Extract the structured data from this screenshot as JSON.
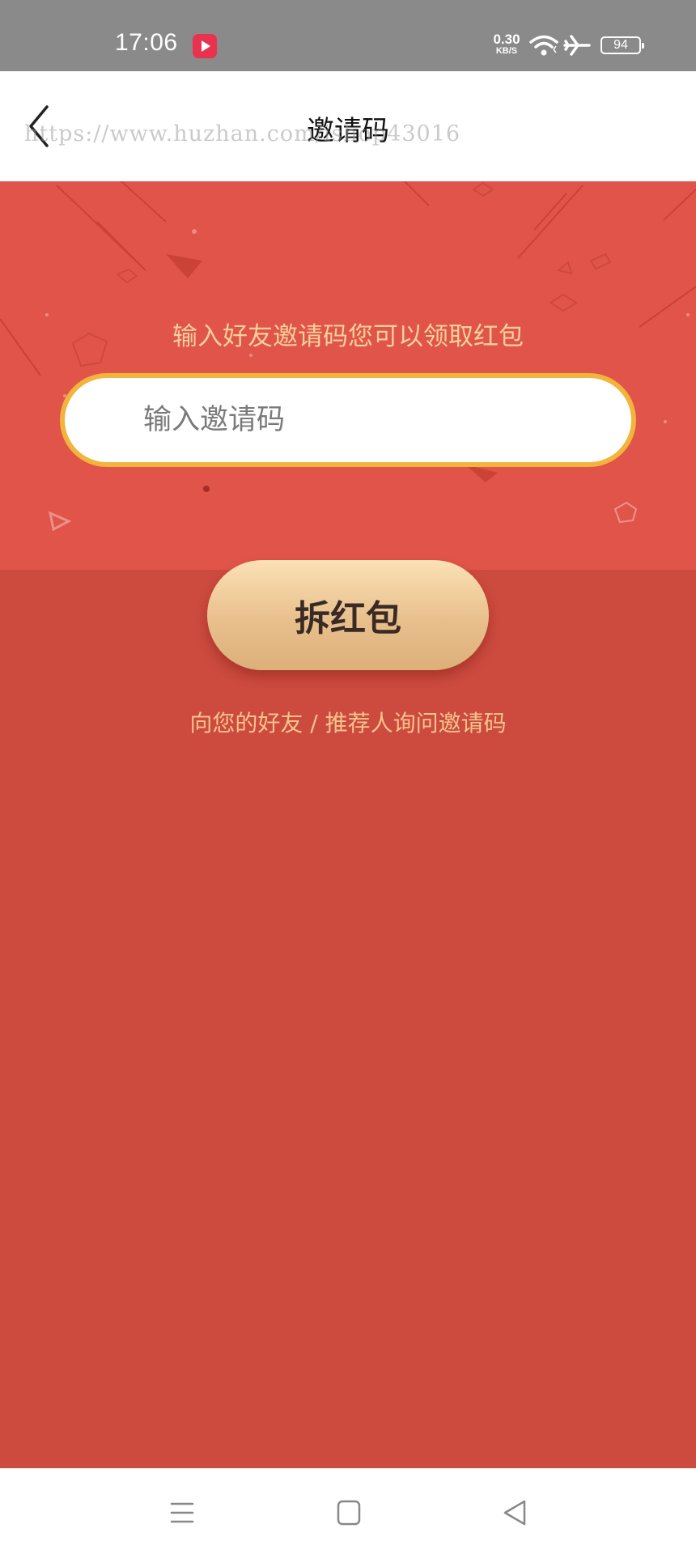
{
  "status_bar": {
    "time": "17:06",
    "net_speed": "0.30",
    "net_speed_unit": "KB/S",
    "battery": "94",
    "icons": [
      "video-app-icon",
      "wifi-icon",
      "airplane-mode-icon",
      "battery-icon"
    ]
  },
  "header": {
    "title": "邀请码",
    "back_icon": "chevron-left-icon",
    "watermark": "https://www.huzhan.com/ishop43016"
  },
  "invite": {
    "hint": "输入好友邀请码您可以领取红包",
    "input_placeholder": "输入邀请码",
    "input_value": "",
    "open_button_label": "拆红包",
    "ask_hint": "向您的好友 / 推荐人询问邀请码"
  },
  "nav_bar": {
    "icons": [
      "menu-icon",
      "home-square-icon",
      "back-triangle-icon"
    ]
  },
  "colors": {
    "status_bar": "#8a8a8a",
    "envelope_top": "#e15449",
    "envelope_body": "#cc4a3e",
    "hint_text": "#f5cf9c",
    "field_border": "#f2b43c",
    "button_gold": "#e8bf8c"
  }
}
